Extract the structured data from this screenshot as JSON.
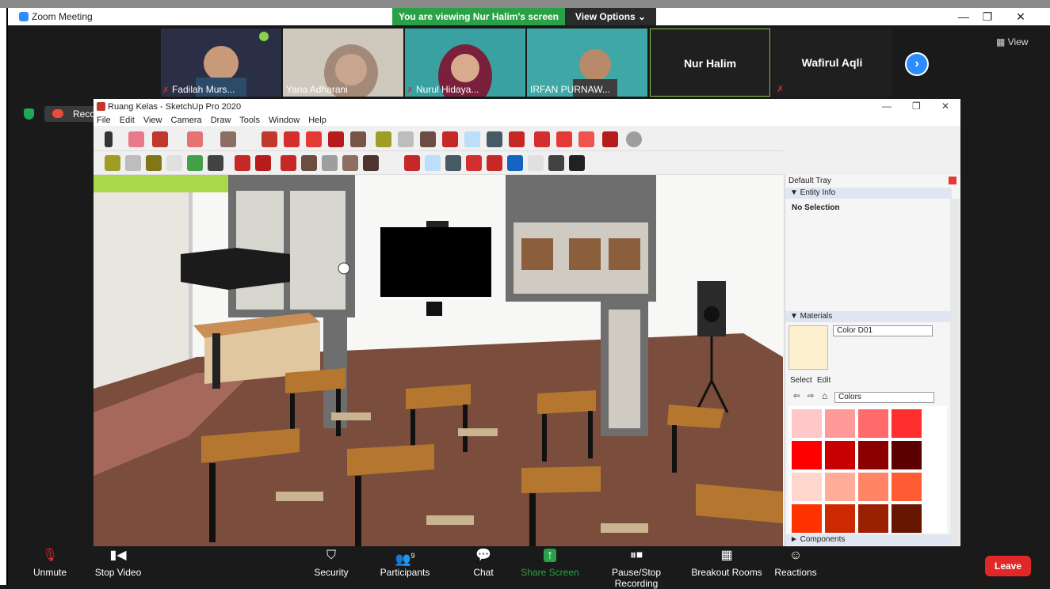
{
  "window": {
    "title": "Zoom Meeting",
    "minimize": "—",
    "restore": "❐",
    "close": "✕"
  },
  "banner": {
    "viewing": "You are viewing Nur Halim's screen",
    "view_options": "View Options ⌄"
  },
  "participants_strip": [
    {
      "name": "Fadilah Murs...",
      "muted": true
    },
    {
      "name": "Yana Adharani",
      "muted": false
    },
    {
      "name": "Nurul Hidaya...",
      "muted": true
    },
    {
      "name": "IRFAN PURNAW...",
      "muted": false
    },
    {
      "name": "Nur Halim",
      "muted": false
    },
    {
      "name": "Wafirul Aqli",
      "muted": true
    }
  ],
  "view_button": "View",
  "recording_label": "Recording...",
  "sketchup": {
    "title": "Ruang Kelas - SketchUp Pro 2020",
    "menu": [
      "File",
      "Edit",
      "View",
      "Camera",
      "Draw",
      "Tools",
      "Window",
      "Help"
    ],
    "tray": {
      "title": "Default Tray",
      "entity_info": "▼ Entity Info",
      "no_selection": "No Selection",
      "materials": "▼ Materials",
      "material_name": "Color D01",
      "select_tab": "Select",
      "edit_tab": "Edit",
      "library": "Colors",
      "components": "► Components"
    },
    "swatches": [
      "#ffc7c7",
      "#ff9a9a",
      "#ff6a6a",
      "#ff2f2f",
      "#ff0000",
      "#c80000",
      "#8c0000",
      "#5a0000",
      "#ffd6cc",
      "#ffad99",
      "#ff8566",
      "#ff5c33",
      "#ff3300",
      "#cc2900",
      "#992000",
      "#661500"
    ]
  },
  "toolbar": {
    "unmute": "Unmute",
    "stop_video": "Stop Video",
    "security": "Security",
    "participants": "Participants",
    "participants_count": "9",
    "chat": "Chat",
    "share_screen": "Share Screen",
    "recording": "Pause/Stop Recording",
    "breakout": "Breakout Rooms",
    "reactions": "Reactions",
    "leave": "Leave"
  },
  "colors": {
    "accent": "#2d8cff",
    "share_green": "#2aa147",
    "leave_red": "#e02828"
  }
}
